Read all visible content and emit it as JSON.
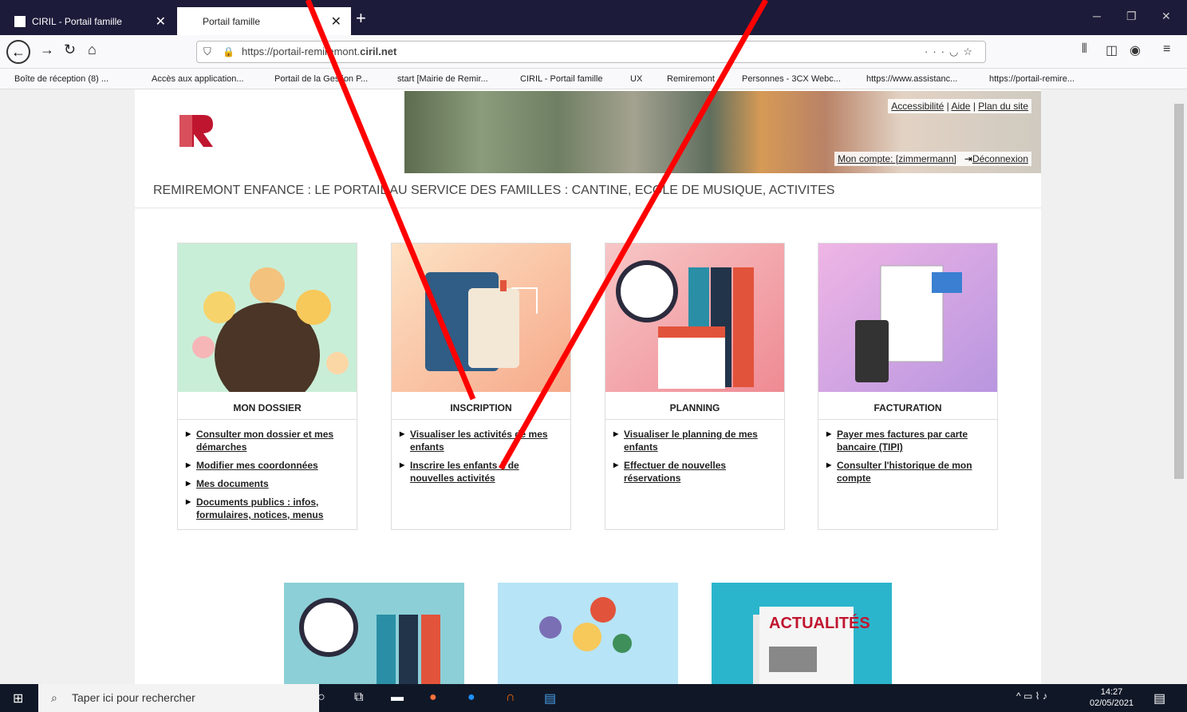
{
  "browser": {
    "tabs": [
      {
        "title": "CIRIL - Portail famille"
      },
      {
        "title": "Portail famille"
      }
    ],
    "url_prefix": "https://portail-remiremont.",
    "url_domain": "ciril.net",
    "bookmarks": [
      "Boîte de réception (8) ...",
      "Accès aux application...",
      "Portail de la Gestion P...",
      "start [Mairie de Remir...",
      "CIRIL - Portail famille",
      "UX",
      "Remiremont",
      "Personnes - 3CX Webc...",
      "https://www.assistanc...",
      "https://portail-remire..."
    ]
  },
  "header": {
    "links": [
      "Accessibilité",
      "Aide",
      "Plan du site"
    ],
    "account": "Mon compte: [zimmermann]",
    "logout": "Déconnexion",
    "tagline": "REMIREMONT ENFANCE : LE PORTAIL AU SERVICE DES FAMILLES : CANTINE, ECOLE DE MUSIQUE, ACTIVITES"
  },
  "cards": [
    {
      "title": "MON DOSSIER",
      "links": [
        "Consulter mon dossier et mes démarches",
        "Modifier mes coordonnées",
        "Mes documents",
        "Documents publics : infos, formulaires, notices, menus"
      ]
    },
    {
      "title": "INSCRIPTION",
      "links": [
        "Visualiser les activités de mes enfants",
        "Inscrire les enfants à de nouvelles activités"
      ]
    },
    {
      "title": "PLANNING",
      "links": [
        "Visualiser le planning de mes enfants",
        "Effectuer de nouvelles réservations"
      ]
    },
    {
      "title": "FACTURATION",
      "links": [
        "Payer mes factures par carte bancaire (TIPI)",
        "Consulter l'historique de mon compte"
      ]
    }
  ],
  "lower_cards": [
    {
      "label": "ACTUALITÉS"
    }
  ],
  "taskbar": {
    "search_placeholder": "Taper ici pour rechercher",
    "time": "14:27",
    "date": "02/05/2021"
  },
  "colors": {
    "annotation_arrow": "#ff0000"
  }
}
